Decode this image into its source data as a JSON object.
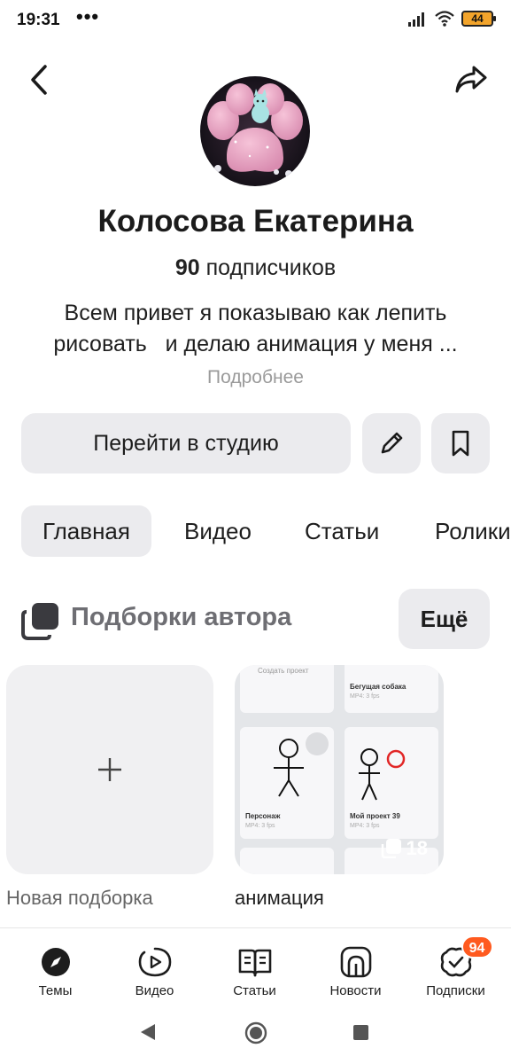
{
  "status_bar": {
    "time": "19:31",
    "dots": "•••",
    "battery": "44",
    "icons": [
      "signal-icon",
      "wifi-icon",
      "battery-icon"
    ]
  },
  "header": {
    "back_icon": "chevron-left-icon",
    "share_icon": "share-icon"
  },
  "profile": {
    "name": "Колосова Екатерина",
    "subscribers_count": "90",
    "subscribers_label": "подписчиков",
    "bio_line1": "Всем привет я показываю как лепить",
    "bio_line2": "рисовать   и делаю анимация у меня ...",
    "more_link": "Подробнее"
  },
  "actions": {
    "studio_button": "Перейти в студию",
    "edit_icon": "pencil-icon",
    "bookmark_icon": "bookmark-icon"
  },
  "tabs": [
    {
      "label": "Главная",
      "active": true
    },
    {
      "label": "Видео",
      "active": false
    },
    {
      "label": "Статьи",
      "active": false
    },
    {
      "label": "Ролики",
      "active": false
    }
  ],
  "collections": {
    "title": "Подборки автора",
    "more_button": "Ещё",
    "new_label": "Новая подборка",
    "items": [
      {
        "label": "анимация",
        "count": "18",
        "preview": {
          "create_project": "Создать проект",
          "project1_title": "Бегущая собака",
          "project1_meta": "MP4: 3 fps",
          "project2_title": "Персонаж",
          "project2_meta": "MP4: 3 fps",
          "project3_title": "Мой проект 39",
          "project3_meta": "MP4: 3 fps"
        }
      }
    ]
  },
  "bottom_nav": [
    {
      "label": "Темы",
      "icon": "compass-icon"
    },
    {
      "label": "Видео",
      "icon": "play-icon"
    },
    {
      "label": "Статьи",
      "icon": "book-icon"
    },
    {
      "label": "Новости",
      "icon": "news-icon"
    },
    {
      "label": "Подписки",
      "icon": "subscriptions-icon",
      "badge": "94"
    }
  ],
  "colors": {
    "accent_badge": "#ff5a1f",
    "button_bg": "#ebebee",
    "section_title": "#6e6e73"
  }
}
